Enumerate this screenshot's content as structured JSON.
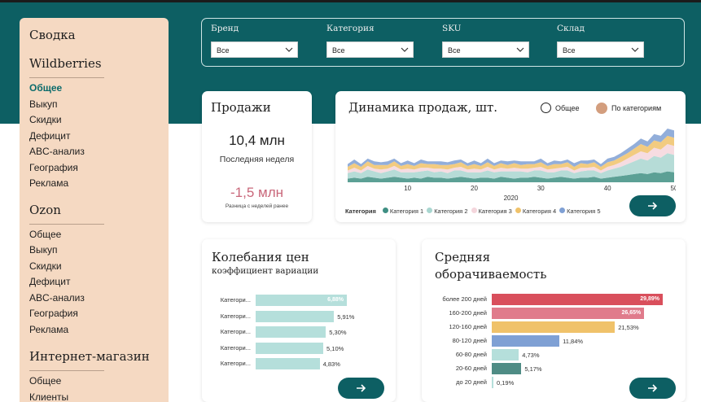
{
  "sidebar": {
    "title": "Сводка",
    "groups": [
      {
        "name": "Wildberries",
        "items": [
          "Общее",
          "Выкуп",
          "Скидки",
          "Дефицит",
          "ABC-анализ",
          "География",
          "Реклама"
        ]
      },
      {
        "name": "Ozon",
        "items": [
          "Общее",
          "Выкуп",
          "Скидки",
          "Дефицит",
          "ABC-анализ",
          "География",
          "Реклама"
        ]
      },
      {
        "name": "Интернет-магазин",
        "items": [
          "Общее",
          "Клиенты"
        ]
      }
    ],
    "active_item": "Общее"
  },
  "filters": [
    {
      "label": "Бренд",
      "value": "Все"
    },
    {
      "label": "Категория",
      "value": "Все"
    },
    {
      "label": "SKU",
      "value": "Все"
    },
    {
      "label": "Склад",
      "value": "Все"
    }
  ],
  "sales": {
    "title": "Продажи",
    "value": "10,4 млн",
    "value_caption": "Последняя неделя",
    "delta": "-1,5 млн",
    "delta_caption": "Разница с неделей ранее"
  },
  "dynamics": {
    "title": "Динамика продаж, шт.",
    "option_total": "Общее",
    "option_by_category": "По категориям",
    "selected_option": "По категориям",
    "x_label": "2020",
    "legend_title": "Категория",
    "series": [
      {
        "name": "Категория 1",
        "color": "#3f8f83"
      },
      {
        "name": "Категория 2",
        "color": "#a9d6d0"
      },
      {
        "name": "Категория 3",
        "color": "#f4d6dc"
      },
      {
        "name": "Категория 4",
        "color": "#f0c26a"
      },
      {
        "name": "Категория 5",
        "color": "#7fa0d4"
      }
    ]
  },
  "chart_data": [
    {
      "type": "area",
      "title": "Динамика продаж, шт.",
      "xlabel": "2020",
      "x_ticks": [
        10,
        20,
        30,
        40,
        50
      ],
      "xlim": [
        1,
        50
      ],
      "stacked": true,
      "series": [
        {
          "name": "Категория 1",
          "values": [
            4,
            5,
            4,
            6,
            5,
            4,
            5,
            6,
            5,
            4,
            5,
            4,
            6,
            5,
            5,
            4,
            5,
            6,
            5,
            4,
            5,
            5,
            4,
            6,
            5,
            4,
            5,
            5,
            6,
            5,
            4,
            5,
            6,
            5,
            4,
            5,
            5,
            6,
            4,
            5,
            6,
            7,
            8,
            9,
            10,
            9,
            11,
            10,
            12,
            11
          ]
        },
        {
          "name": "Категория 2",
          "values": [
            6,
            7,
            6,
            8,
            7,
            6,
            7,
            8,
            6,
            7,
            6,
            8,
            7,
            6,
            7,
            6,
            8,
            7,
            6,
            7,
            6,
            8,
            7,
            6,
            7,
            8,
            7,
            6,
            7,
            8,
            7,
            6,
            7,
            8,
            6,
            7,
            8,
            7,
            6,
            8,
            9,
            10,
            12,
            14,
            16,
            15,
            18,
            17,
            20,
            19
          ]
        },
        {
          "name": "Категория 3",
          "values": [
            3,
            4,
            3,
            4,
            3,
            4,
            3,
            4,
            3,
            4,
            3,
            4,
            3,
            4,
            3,
            4,
            3,
            4,
            3,
            4,
            3,
            4,
            3,
            4,
            3,
            4,
            3,
            4,
            3,
            4,
            3,
            4,
            3,
            4,
            3,
            4,
            3,
            4,
            3,
            4,
            4,
            5,
            6,
            7,
            8,
            8,
            9,
            9,
            10,
            10
          ]
        },
        {
          "name": "Категория 4",
          "values": [
            4,
            5,
            4,
            5,
            4,
            5,
            4,
            5,
            4,
            5,
            4,
            5,
            4,
            5,
            4,
            5,
            4,
            5,
            4,
            5,
            4,
            5,
            4,
            5,
            4,
            5,
            4,
            5,
            4,
            5,
            4,
            5,
            4,
            5,
            4,
            5,
            4,
            5,
            4,
            5,
            5,
            6,
            6,
            7,
            8,
            7,
            8,
            8,
            9,
            9
          ]
        },
        {
          "name": "Категория 5",
          "values": [
            3,
            4,
            3,
            3,
            4,
            3,
            4,
            3,
            3,
            4,
            3,
            4,
            3,
            3,
            4,
            3,
            4,
            3,
            3,
            4,
            3,
            4,
            3,
            3,
            4,
            3,
            4,
            3,
            3,
            4,
            3,
            4,
            3,
            3,
            4,
            3,
            4,
            3,
            3,
            4,
            4,
            4,
            5,
            5,
            6,
            6,
            7,
            7,
            8,
            8
          ]
        }
      ]
    },
    {
      "type": "bar",
      "orientation": "horizontal",
      "title": "Колебания цен",
      "subtitle": "коэффициент вариации",
      "categories": [
        "Категори...",
        "Категори...",
        "Категори...",
        "Категори...",
        "Категори..."
      ],
      "values": [
        6.88,
        5.91,
        5.3,
        5.1,
        4.83
      ],
      "value_labels": [
        "6,88%",
        "5,91%",
        "5,30%",
        "5,10%",
        "4,83%"
      ],
      "color": "#b5dfdb"
    },
    {
      "type": "bar",
      "orientation": "horizontal",
      "title": "Средняя оборачиваемость",
      "categories": [
        "более 200 дней",
        "160-200 дней",
        "120-160 дней",
        "80-120 дней",
        "60-80 дней",
        "20-60 дней",
        "до 20 дней"
      ],
      "values": [
        29.89,
        26.65,
        21.53,
        11.84,
        4.73,
        5.17,
        0.19
      ],
      "value_labels": [
        "29,89%",
        "26,65%",
        "21,53%",
        "11,84%",
        "4,73%",
        "5,17%",
        "0,19%"
      ],
      "colors": [
        "#d94f5c",
        "#e07b8b",
        "#f0c26a",
        "#7fa0d4",
        "#b5dfdb",
        "#4f8c85",
        "#b5dfdb"
      ]
    }
  ],
  "prices": {
    "title": "Колебания цен",
    "subtitle": "коэффициент вариации"
  },
  "turnover": {
    "title_line1": "Средняя",
    "title_line2": "оборачиваемость"
  }
}
